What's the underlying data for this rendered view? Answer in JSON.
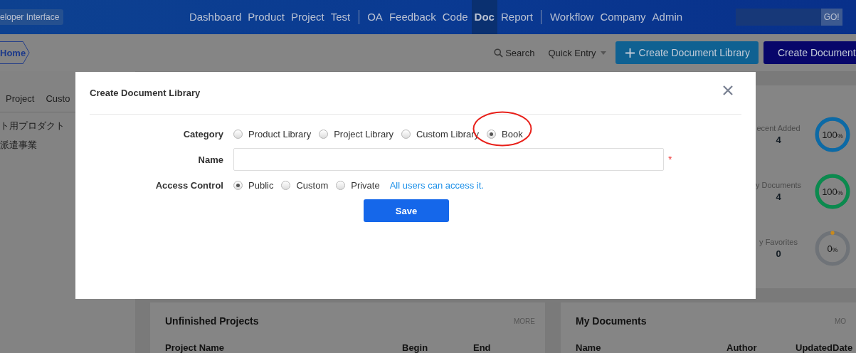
{
  "top_bar": {
    "brand": "eloper Interface",
    "nav_groups": [
      {
        "items": [
          {
            "label": "Dashboard",
            "selected": false
          },
          {
            "label": "Product",
            "selected": false
          },
          {
            "label": "Project",
            "selected": false
          },
          {
            "label": "Test",
            "selected": false
          }
        ]
      },
      {
        "items": [
          {
            "label": "OA",
            "selected": false
          },
          {
            "label": "Feedback",
            "selected": false
          },
          {
            "label": "Code",
            "selected": false
          },
          {
            "label": "Doc",
            "selected": true
          },
          {
            "label": "Report",
            "selected": false
          }
        ]
      },
      {
        "items": [
          {
            "label": "Workflow",
            "selected": false
          },
          {
            "label": "Company",
            "selected": false
          },
          {
            "label": "Admin",
            "selected": false
          }
        ]
      }
    ],
    "search_button": "GO!"
  },
  "toolbar": {
    "breadcrumb": "Home",
    "search": "Search",
    "quick_entry": "Quick Entry",
    "buttons": [
      {
        "label": "Create Document Library",
        "kind": "primary"
      },
      {
        "label": "Create Document",
        "kind": "dark"
      }
    ]
  },
  "left_panel": {
    "tabs": [
      "Project",
      "Custo"
    ],
    "items": [
      "ト用プロダクト",
      "派遣事業"
    ]
  },
  "stats": [
    {
      "label": "ecent Added",
      "count": "4",
      "percent": "100",
      "unit": "%",
      "color": "#0c6aa6"
    },
    {
      "label": "y Documents",
      "count": "4",
      "percent": "100",
      "unit": "%",
      "color": "#0b8a4e"
    },
    {
      "label": "y Favorites",
      "count": "0",
      "percent": "0",
      "unit": "%",
      "color": "#c98a1c"
    }
  ],
  "cards": [
    {
      "title": "Unfinished Projects",
      "more": "MORE",
      "columns": [
        "Project Name",
        "Begin",
        "End"
      ]
    },
    {
      "title": "My Documents",
      "more": "MO",
      "columns": [
        "Name",
        "Author",
        "UpdatedDate"
      ]
    }
  ],
  "dialog": {
    "title": "Create Document Library",
    "fields": [
      {
        "label": "Category",
        "kind": "radio",
        "options": [
          {
            "label": "Product Library",
            "selected": false,
            "circled": false
          },
          {
            "label": "Project Library",
            "selected": false,
            "circled": false
          },
          {
            "label": "Custom Library",
            "selected": false,
            "circled": false
          },
          {
            "label": "Book",
            "selected": true,
            "circled": true
          }
        ]
      },
      {
        "label": "Name",
        "kind": "text",
        "required_mark": "*"
      },
      {
        "label": "Access Control",
        "kind": "radio",
        "options": [
          {
            "label": "Public",
            "selected": true,
            "circled": false
          },
          {
            "label": "Custom",
            "selected": false,
            "circled": false
          },
          {
            "label": "Private",
            "selected": false,
            "circled": false
          }
        ],
        "hint": "All users can access it."
      }
    ],
    "save": "Save"
  }
}
